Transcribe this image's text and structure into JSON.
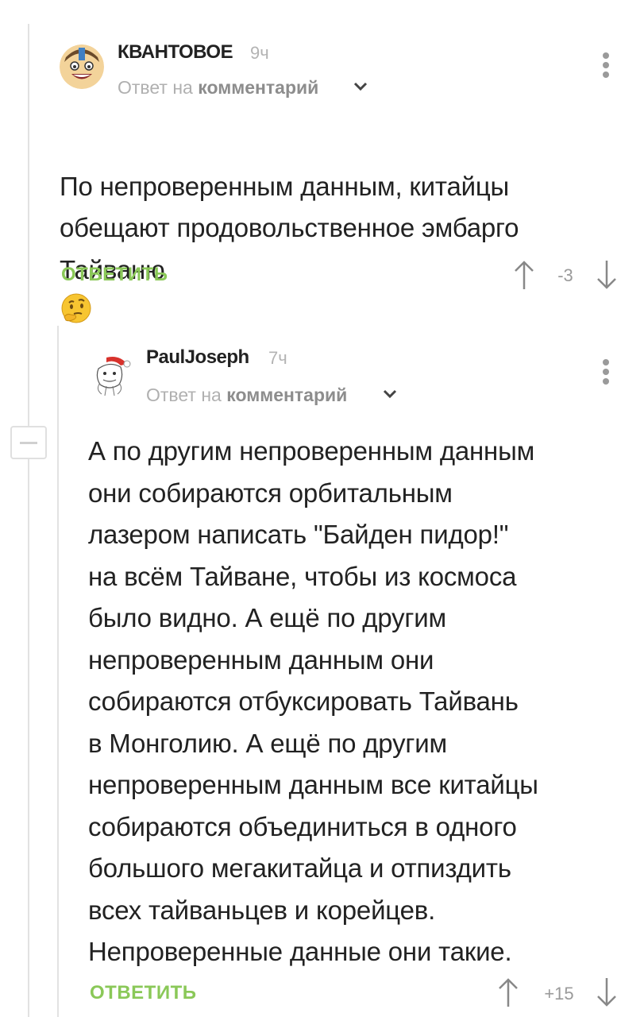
{
  "comments": [
    {
      "author": "КВАНТОВОЕ",
      "time": "9ч",
      "reply_prefix": "Ответ на",
      "reply_target": "комментарий",
      "text": "По непроверенным данным, китайцы\nобещают продовольственное эмбарго\nТайваню",
      "emoji": "thinking-face",
      "reply_label": "ОТВЕТИТЬ",
      "rating": "-3"
    },
    {
      "author": "PaulJoseph",
      "time": "7ч",
      "reply_prefix": "Ответ на",
      "reply_target": "комментарий",
      "text": "А по другим непроверенным данным\nони собираются орбитальным\nлазером написать \"Байден пидор!\"\nна всём Тайване, чтобы из космоса\nбыло видно. А ещё по другим\nнепроверенным данным они\nсобираются отбуксировать Тайвань\nв Монголию. А ещё по другим\nнепроверенным данным все китайцы\nсобираются объединиться в одного\nбольшого мегакитайца и отпиздить\nвсех тайваньцев и корейцев.\nНепроверенные данные они такие.",
      "reply_label": "ОТВЕТИТЬ",
      "rating": "+15"
    }
  ],
  "colors": {
    "accent_green": "#8ac858",
    "muted_text": "#b0b0b0",
    "thread_line": "#e2e2e2"
  }
}
